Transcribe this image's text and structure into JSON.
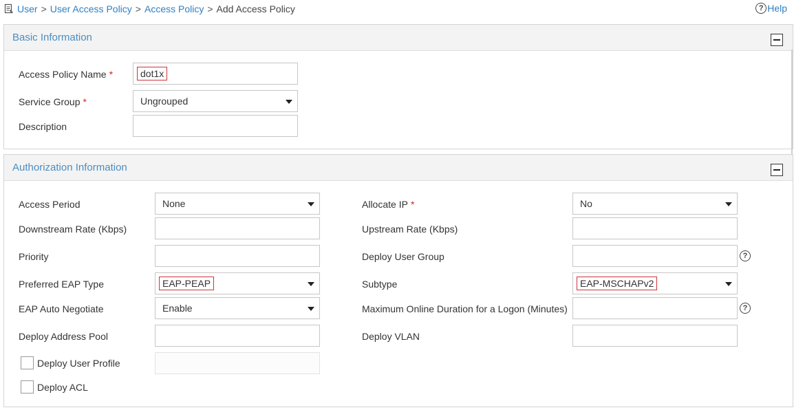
{
  "breadcrumb": {
    "items": [
      "User",
      "User Access Policy",
      "Access Policy"
    ],
    "separator": ">",
    "current": "Add Access Policy"
  },
  "help": {
    "label": "Help"
  },
  "basic": {
    "title": "Basic Information",
    "policy_name_label": "Access Policy Name",
    "policy_name_value": "dot1x",
    "service_group_label": "Service Group",
    "service_group_value": "Ungrouped",
    "description_label": "Description",
    "description_value": "",
    "required_mark": "*"
  },
  "auth": {
    "title": "Authorization Information",
    "required_mark": "*",
    "left": {
      "access_period_label": "Access Period",
      "access_period_value": "None",
      "downstream_label": "Downstream Rate (Kbps)",
      "downstream_value": "",
      "priority_label": "Priority",
      "priority_value": "",
      "eap_type_label": "Preferred EAP Type",
      "eap_type_value": "EAP-PEAP",
      "eap_auto_label": "EAP Auto Negotiate",
      "eap_auto_value": "Enable",
      "addr_pool_label": "Deploy Address Pool",
      "addr_pool_value": "",
      "user_profile_label": "Deploy User Profile",
      "user_profile_checked": false,
      "acl_label": "Deploy ACL",
      "acl_checked": false
    },
    "right": {
      "allocate_ip_label": "Allocate IP",
      "allocate_ip_value": "No",
      "upstream_label": "Upstream Rate (Kbps)",
      "upstream_value": "",
      "user_group_label": "Deploy User Group",
      "user_group_value": "",
      "subtype_label": "Subtype",
      "subtype_value": "EAP-MSCHAPv2",
      "max_duration_label": "Maximum Online Duration for a Logon (Minutes)",
      "max_duration_value": "",
      "vlan_label": "Deploy VLAN",
      "vlan_value": ""
    }
  },
  "icons": {
    "help": "question-circle-icon",
    "collapse": "minus-square-icon",
    "breadcrumb": "document-icon",
    "dropdown": "caret-down-icon"
  },
  "colors": {
    "link": "#2f7fc2",
    "panel_title": "#4a8dc3",
    "required": "#d9261c",
    "highlight_box": "#d0313a"
  }
}
